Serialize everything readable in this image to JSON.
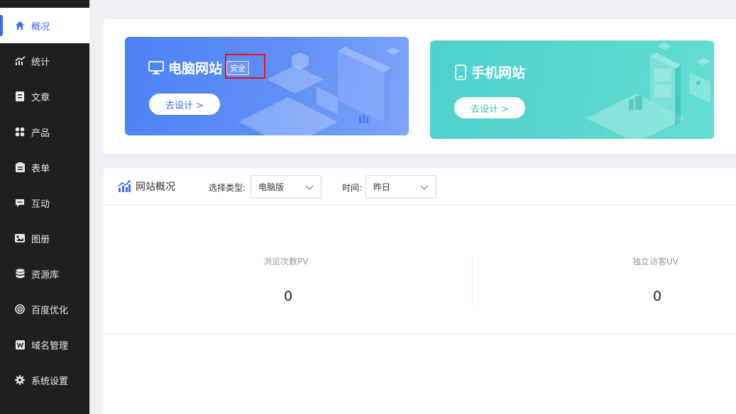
{
  "sidebar": {
    "items": [
      {
        "label": "概况",
        "icon": "home-icon",
        "active": true
      },
      {
        "label": "统计",
        "icon": "chart-icon"
      },
      {
        "label": "文章",
        "icon": "article-icon"
      },
      {
        "label": "产品",
        "icon": "grid-icon"
      },
      {
        "label": "表单",
        "icon": "clipboard-icon"
      },
      {
        "label": "互动",
        "icon": "chat-icon"
      },
      {
        "label": "图册",
        "icon": "image-icon"
      },
      {
        "label": "资源库",
        "icon": "database-icon"
      },
      {
        "label": "百度优化",
        "icon": "target-icon"
      },
      {
        "label": "域名管理",
        "icon": "w-icon"
      },
      {
        "label": "系统设置",
        "icon": "gear-icon"
      }
    ]
  },
  "cards": {
    "pc": {
      "title": "电脑网站",
      "tag": "安全",
      "button": "去设计 >"
    },
    "mobile": {
      "title": "手机网站",
      "button": "去设计 >"
    }
  },
  "overview": {
    "title": "网站概况",
    "type_label": "选择类型:",
    "type_value": "电脑版",
    "time_label": "时间:",
    "time_value": "昨日",
    "stats": [
      {
        "label": "浏览次数PV",
        "value": "0"
      },
      {
        "label": "独立访客UV",
        "value": "0"
      }
    ]
  },
  "colors": {
    "accent": "#3c6df0",
    "sidebar_bg": "#1f1f1f",
    "highlight": "#e0121a"
  }
}
